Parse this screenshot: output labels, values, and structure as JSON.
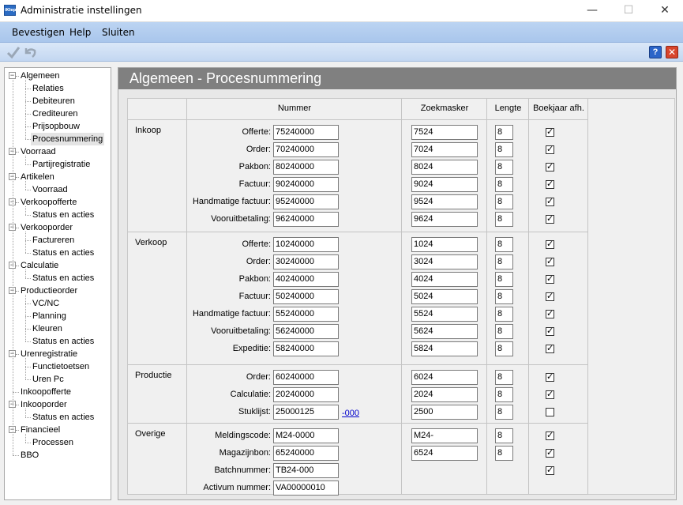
{
  "window": {
    "title": "Administratie instellingen",
    "app_icon_text": "iKlep",
    "minimize": "—",
    "maximize": "☐",
    "close": "✕"
  },
  "menu": {
    "items": [
      "Bevestigen",
      "Help",
      "Sluiten"
    ]
  },
  "toolbar": {
    "help": "?",
    "close": "✕"
  },
  "sidebar": {
    "items": [
      {
        "label": "Algemeen",
        "level": 0,
        "expander": true
      },
      {
        "label": "Relaties",
        "level": 1
      },
      {
        "label": "Debiteuren",
        "level": 1
      },
      {
        "label": "Crediteuren",
        "level": 1
      },
      {
        "label": "Prijsopbouw",
        "level": 1
      },
      {
        "label": "Procesnummering",
        "level": 1,
        "selected": true
      },
      {
        "label": "Voorraad",
        "level": 0,
        "expander": true
      },
      {
        "label": "Partijregistratie",
        "level": 1
      },
      {
        "label": "Artikelen",
        "level": 0,
        "expander": true
      },
      {
        "label": "Voorraad",
        "level": 1
      },
      {
        "label": "Verkoopofferte",
        "level": 0,
        "expander": true
      },
      {
        "label": "Status en acties",
        "level": 1
      },
      {
        "label": "Verkooporder",
        "level": 0,
        "expander": true
      },
      {
        "label": "Factureren",
        "level": 1
      },
      {
        "label": "Status en acties",
        "level": 1
      },
      {
        "label": "Calculatie",
        "level": 0,
        "expander": true
      },
      {
        "label": "Status en acties",
        "level": 1
      },
      {
        "label": "Productieorder",
        "level": 0,
        "expander": true
      },
      {
        "label": "VC/NC",
        "level": 1
      },
      {
        "label": "Planning",
        "level": 1
      },
      {
        "label": "Kleuren",
        "level": 1
      },
      {
        "label": "Status en acties",
        "level": 1
      },
      {
        "label": "Urenregistratie",
        "level": 0,
        "expander": true
      },
      {
        "label": "Functietoetsen",
        "level": 1
      },
      {
        "label": "Uren Pc",
        "level": 1
      },
      {
        "label": "Inkoopofferte",
        "level": 0,
        "expander": false
      },
      {
        "label": "Inkooporder",
        "level": 0,
        "expander": true
      },
      {
        "label": "Status en acties",
        "level": 1
      },
      {
        "label": "Financieel",
        "level": 0,
        "expander": true
      },
      {
        "label": "Processen",
        "level": 1
      },
      {
        "label": "BBO",
        "level": 0,
        "expander": false
      }
    ]
  },
  "content": {
    "header": "Algemeen - Procesnummering",
    "columns": {
      "nummer": "Nummer",
      "zoekmasker": "Zoekmasker",
      "lengte": "Lengte",
      "boekjaar": "Boekjaar afh."
    },
    "groups": [
      {
        "name": "Inkoop",
        "rows": [
          {
            "label": "Offerte:",
            "nummer": "75240000",
            "zoekmasker": "7524",
            "lengte": "8",
            "boekjaar": true
          },
          {
            "label": "Order:",
            "nummer": "70240000",
            "zoekmasker": "7024",
            "lengte": "8",
            "boekjaar": true
          },
          {
            "label": "Pakbon:",
            "nummer": "80240000",
            "zoekmasker": "8024",
            "lengte": "8",
            "boekjaar": true
          },
          {
            "label": "Factuur:",
            "nummer": "90240000",
            "zoekmasker": "9024",
            "lengte": "8",
            "boekjaar": true
          },
          {
            "label": "Handmatige factuur:",
            "nummer": "95240000",
            "zoekmasker": "9524",
            "lengte": "8",
            "boekjaar": true
          },
          {
            "label": "Vooruitbetaling:",
            "nummer": "96240000",
            "zoekmasker": "9624",
            "lengte": "8",
            "boekjaar": true
          }
        ]
      },
      {
        "name": "Verkoop",
        "rows": [
          {
            "label": "Offerte:",
            "nummer": "10240000",
            "zoekmasker": "1024",
            "lengte": "8",
            "boekjaar": true
          },
          {
            "label": "Order:",
            "nummer": "30240000",
            "zoekmasker": "3024",
            "lengte": "8",
            "boekjaar": true
          },
          {
            "label": "Pakbon:",
            "nummer": "40240000",
            "zoekmasker": "4024",
            "lengte": "8",
            "boekjaar": true
          },
          {
            "label": "Factuur:",
            "nummer": "50240000",
            "zoekmasker": "5024",
            "lengte": "8",
            "boekjaar": true
          },
          {
            "label": "Handmatige factuur:",
            "nummer": "55240000",
            "zoekmasker": "5524",
            "lengte": "8",
            "boekjaar": true
          },
          {
            "label": "Vooruitbetaling:",
            "nummer": "56240000",
            "zoekmasker": "5624",
            "lengte": "8",
            "boekjaar": true
          },
          {
            "label": "Expeditie:",
            "nummer": "58240000",
            "zoekmasker": "5824",
            "lengte": "8",
            "boekjaar": true
          }
        ]
      },
      {
        "name": "Productie",
        "rows": [
          {
            "label": "Order:",
            "nummer": "60240000",
            "zoekmasker": "6024",
            "lengte": "8",
            "boekjaar": true
          },
          {
            "label": "Calculatie:",
            "nummer": "20240000",
            "zoekmasker": "2024",
            "lengte": "8",
            "boekjaar": true
          },
          {
            "label": "Stuklijst:",
            "nummer": "25000125",
            "link": "-000",
            "zoekmasker": "2500",
            "lengte": "8",
            "boekjaar": false
          }
        ]
      },
      {
        "name": "Overige",
        "rows": [
          {
            "label": "Meldingscode:",
            "nummer": "M24-0000",
            "zoekmasker": "M24-",
            "lengte": "8",
            "boekjaar": true
          },
          {
            "label": "Magazijnbon:",
            "nummer": "65240000",
            "zoekmasker": "6524",
            "lengte": "8",
            "boekjaar": true
          },
          {
            "label": "Batchnummer:",
            "nummer": "TB24-000",
            "boekjaar": true
          },
          {
            "label": "Activum nummer:",
            "nummer": "VA00000010"
          }
        ]
      }
    ]
  }
}
